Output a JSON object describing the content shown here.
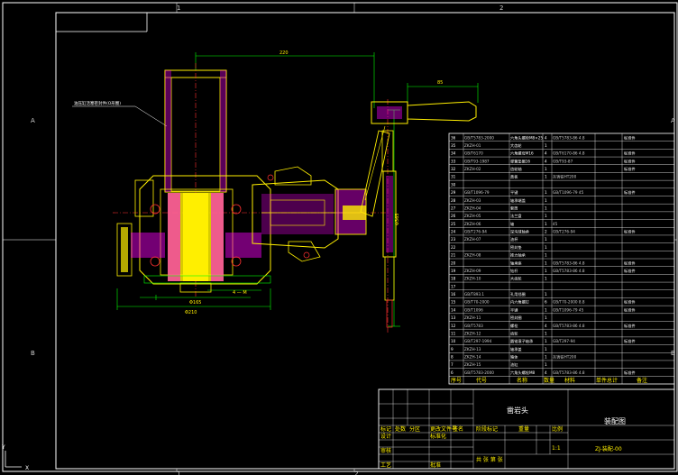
{
  "drawing": {
    "zone_left_top": "A",
    "zone_left_bottom": "B",
    "zone_right_top": "A",
    "zone_right_bottom": "B",
    "zone_top_1": "1",
    "zone_top_2": "2",
    "zone_bottom_1": "1",
    "zone_bottom_2": "2",
    "dim_top": "220",
    "dim_handle": "85",
    "dim_vertical": "Φ365",
    "dim_base": "Φ210",
    "dim_inner": "Φ165",
    "dim_small": "4 — M",
    "leader_note": "油压缸活塞密封件(O形圈)"
  },
  "bom": {
    "rows": [
      {
        "no": "36",
        "code": "GB/T5783-2000",
        "name": "六角头螺栓M8×25",
        "qty": "4",
        "mat": "GB/T5783-86 4.8",
        "note": "标准件"
      },
      {
        "no": "35",
        "code": "ZKZH-01",
        "name": "大齿轮",
        "qty": "1",
        "mat": "",
        "note": ""
      },
      {
        "no": "34",
        "code": "GB/T6170",
        "name": "六角螺母M16",
        "qty": "4",
        "mat": "GB/T6170-86 4.8",
        "note": "标准件"
      },
      {
        "no": "33",
        "code": "GB/T93-1987",
        "name": "弹簧垫圈16",
        "qty": "4",
        "mat": "GB/T93-87",
        "note": "标准件"
      },
      {
        "no": "32",
        "code": "ZKZH-02",
        "name": "齿轮轴",
        "qty": "1",
        "mat": "",
        "note": "标准件"
      },
      {
        "no": "31",
        "code": "",
        "name": "盖板",
        "qty": "1",
        "mat": "灰铸铁HT200",
        "note": ""
      },
      {
        "no": "30",
        "code": "",
        "name": "",
        "qty": "",
        "mat": "",
        "note": ""
      },
      {
        "no": "29",
        "code": "GB/T1096-79",
        "name": "平键",
        "qty": "1",
        "mat": "GB/T1096-79 45",
        "note": "标准件"
      },
      {
        "no": "28",
        "code": "ZKZH-03",
        "name": "轴承端盖",
        "qty": "1",
        "mat": "",
        "note": ""
      },
      {
        "no": "27",
        "code": "ZKZH-04",
        "name": "套筒",
        "qty": "1",
        "mat": "",
        "note": ""
      },
      {
        "no": "26",
        "code": "ZKZH-05",
        "name": "法兰盘",
        "qty": "1",
        "mat": "",
        "note": ""
      },
      {
        "no": "25",
        "code": "ZKZH-06",
        "name": "轴",
        "qty": "1",
        "mat": "45",
        "note": ""
      },
      {
        "no": "24",
        "code": "GB/T276-94",
        "name": "深沟球轴承",
        "qty": "2",
        "mat": "GB/T276-94",
        "note": "标准件"
      },
      {
        "no": "23",
        "code": "ZKZH-07",
        "name": "油杯",
        "qty": "1",
        "mat": "",
        "note": ""
      },
      {
        "no": "22",
        "code": "",
        "name": "密封垫",
        "qty": "1",
        "mat": "",
        "note": ""
      },
      {
        "no": "21",
        "code": "ZKZH-08",
        "name": "推力轴承",
        "qty": "1",
        "mat": "",
        "note": ""
      },
      {
        "no": "20",
        "code": "",
        "name": "轴承座",
        "qty": "1",
        "mat": "GB/T5783-86 4.8",
        "note": "标准件"
      },
      {
        "no": "19",
        "code": "ZKZH-09",
        "name": "钻杆",
        "qty": "1",
        "mat": "GB/T5783-86 4.8",
        "note": "标准件"
      },
      {
        "no": "18",
        "code": "ZKZH-10",
        "name": "大齿轮",
        "qty": "1",
        "mat": "",
        "note": ""
      },
      {
        "no": "17",
        "code": "",
        "name": "",
        "qty": "",
        "mat": "",
        "note": ""
      },
      {
        "no": "16",
        "code": "GB/T893.1",
        "name": "孔用挡圈",
        "qty": "1",
        "mat": "",
        "note": ""
      },
      {
        "no": "15",
        "code": "GB/T70-2000",
        "name": "内六角螺钉",
        "qty": "6",
        "mat": "GB/T70-2000 8.8",
        "note": "标准件"
      },
      {
        "no": "14",
        "code": "GB/T1096",
        "name": "平键",
        "qty": "1",
        "mat": "GB/T1096-79 45",
        "note": "标准件"
      },
      {
        "no": "13",
        "code": "ZKZH-11",
        "name": "密封圈",
        "qty": "1",
        "mat": "",
        "note": ""
      },
      {
        "no": "12",
        "code": "GB/T5783",
        "name": "螺栓",
        "qty": "4",
        "mat": "GB/T5783-86 4.8",
        "note": "标准件"
      },
      {
        "no": "11",
        "code": "ZKZH-12",
        "name": "齿轮",
        "qty": "1",
        "mat": "",
        "note": ""
      },
      {
        "no": "10",
        "code": "GB/T297-1994",
        "name": "圆锥滚子轴承",
        "qty": "1",
        "mat": "GB/T297-94",
        "note": "标准件"
      },
      {
        "no": "9",
        "code": "ZKZH-13",
        "name": "轴承盖",
        "qty": "1",
        "mat": "",
        "note": ""
      },
      {
        "no": "8",
        "code": "ZKZH-14",
        "name": "箱体",
        "qty": "1",
        "mat": "灰铸铁HT200",
        "note": ""
      },
      {
        "no": "7",
        "code": "ZKZH-15",
        "name": "油缸",
        "qty": "1",
        "mat": "",
        "note": ""
      },
      {
        "no": "6",
        "code": "GB/T5783-2000",
        "name": "六角头螺栓M8",
        "qty": "4",
        "mat": "GB/T5783-86 4.8",
        "note": "标准件"
      }
    ],
    "header": {
      "no": "序号",
      "code": "代号",
      "name": "名称",
      "qty": "数量",
      "mat": "材料",
      "weight": "单件总计",
      "note": "备注"
    }
  },
  "title_block": {
    "title": "凿岩头",
    "drawing_type": "装配图",
    "drawing_no": "ZJ-装配-00",
    "scale": "1:1",
    "row_design": "设计",
    "row_check": "审核",
    "row_process": "工艺",
    "row_mark": "标记",
    "row_count": "处数",
    "row_zone": "分区",
    "row_change": "更改文件号",
    "row_sign": "签名",
    "row_date": "年月日",
    "row_std": "标准化",
    "row_approve": "批准",
    "col_stage": "阶段标记",
    "col_weight": "重量",
    "col_scale": "比例",
    "col_sheet": "共 张 第 张"
  },
  "colors": {
    "background": "#000000",
    "frame": "#ffffff",
    "part": "#ffef00",
    "hatch": "#ff00ff",
    "center": "#ff3030",
    "dim": "#00ff00",
    "table": "#ffffff"
  }
}
